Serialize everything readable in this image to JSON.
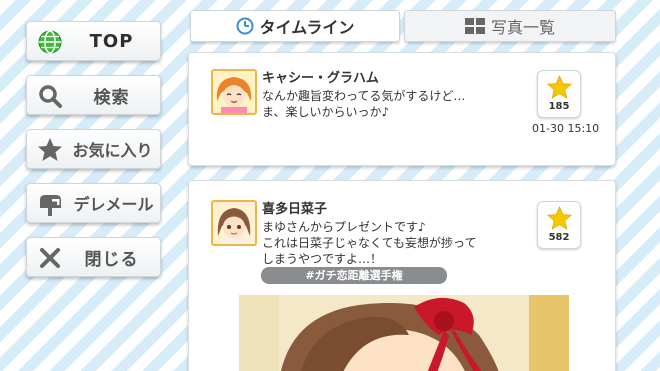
{
  "menu": {
    "top": "TOP",
    "search": "検索",
    "favorites": "お気に入り",
    "deremail": "デレメール",
    "close": "閉じる"
  },
  "tabs": {
    "timeline": "タイムライン",
    "photos": "写真一覧"
  },
  "posts": [
    {
      "author": "キャシー・グラハム",
      "line1": "なんか趣旨変わってる気がするけど…",
      "line2": "ま、楽しいからいっか♪",
      "likes": "185",
      "timestamp": "01-30 15:10"
    },
    {
      "author": "喜多日菜子",
      "line1": "まゆさんからプレゼントです♪",
      "line2": "これは日菜子じゃなくても妄想が捗って",
      "line3": "しまうやつですよ…！",
      "likes": "582",
      "hashtag": "#ガチ恋距離選手権"
    }
  ],
  "colors": {
    "accent_star": "#f5c800",
    "avatar_border": "#f0b44a",
    "hashtag_bg": "#8a8d90",
    "stripe": "#d6ecf8"
  },
  "icons": [
    "globe-icon",
    "search-icon",
    "star-icon",
    "mail-icon",
    "close-icon",
    "clock-icon",
    "grid-icon"
  ]
}
